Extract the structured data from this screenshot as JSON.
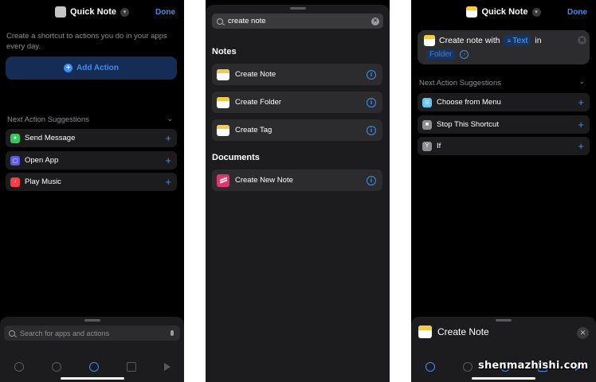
{
  "panel1": {
    "nav": {
      "title": "Quick Note",
      "done": "Done"
    },
    "description": "Create a shortcut to actions you do in your apps every day.",
    "add_action": "Add Action",
    "suggestions_header": "Next Action Suggestions",
    "suggestions": [
      {
        "label": "Send Message",
        "icon": "messages-icon",
        "color": "#34c759"
      },
      {
        "label": "Open App",
        "icon": "open-app-icon",
        "color": "#5e5ce6"
      },
      {
        "label": "Play Music",
        "icon": "music-icon",
        "color": "#fc3c44"
      }
    ],
    "search_placeholder": "Search for apps and actions"
  },
  "panel2": {
    "search_value": "create note",
    "sections": [
      {
        "title": "Notes",
        "items": [
          "Create Note",
          "Create Folder",
          "Create Tag"
        ]
      },
      {
        "title": "Documents",
        "items": [
          "Create New Note"
        ]
      }
    ]
  },
  "panel3": {
    "nav": {
      "title": "Quick Note",
      "done": "Done"
    },
    "action": {
      "verb": "Create note with",
      "param": "Text",
      "connector": "in",
      "folder": "Folder"
    },
    "suggestions_header": "Next Action Suggestions",
    "suggestions": [
      {
        "label": "Choose from Menu",
        "icon": "menu-icon",
        "color": "#5ac8fa"
      },
      {
        "label": "Stop This Shortcut",
        "icon": "stop-icon",
        "color": "#8e8e93"
      },
      {
        "label": "If",
        "icon": "if-icon",
        "color": "#8e8e93"
      }
    ],
    "sheet_title": "Create Note"
  },
  "watermark": "shenmazhishi.com",
  "colors": {
    "accent": "#3a8ff7",
    "background": "#000000",
    "row": "#1c1c1e"
  }
}
